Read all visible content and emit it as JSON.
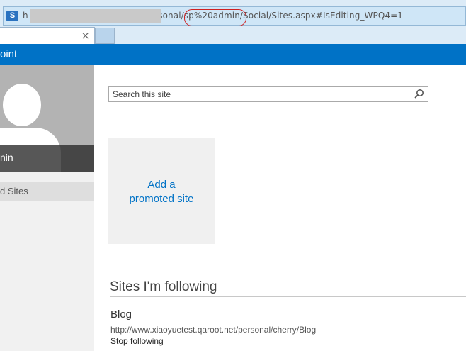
{
  "address_bar": {
    "favicon": "sharepoint-icon",
    "url_prefix": "h",
    "url_visible": "ersonal/sp%20admin/Social/Sites.aspx#IsEditing_WPQ4=1"
  },
  "tab": {
    "close_label": "×"
  },
  "suite_bar": {
    "brand": "oint"
  },
  "profile": {
    "name": "nin"
  },
  "left_nav": {
    "items": [
      {
        "label": "d Sites"
      }
    ]
  },
  "search": {
    "placeholder": "Search this site",
    "icon": "search-icon"
  },
  "promoted": {
    "add_label": "Add a promoted site"
  },
  "following": {
    "title": "Sites I'm following",
    "sites": [
      {
        "name": "Blog",
        "url": "http://www.xiaoyuetest.qaroot.net/personal/cherry/Blog",
        "action": "Stop following"
      }
    ]
  },
  "colors": {
    "suite_bar": "#0072c6",
    "link": "#0072c6",
    "annotation": "#d02020"
  }
}
